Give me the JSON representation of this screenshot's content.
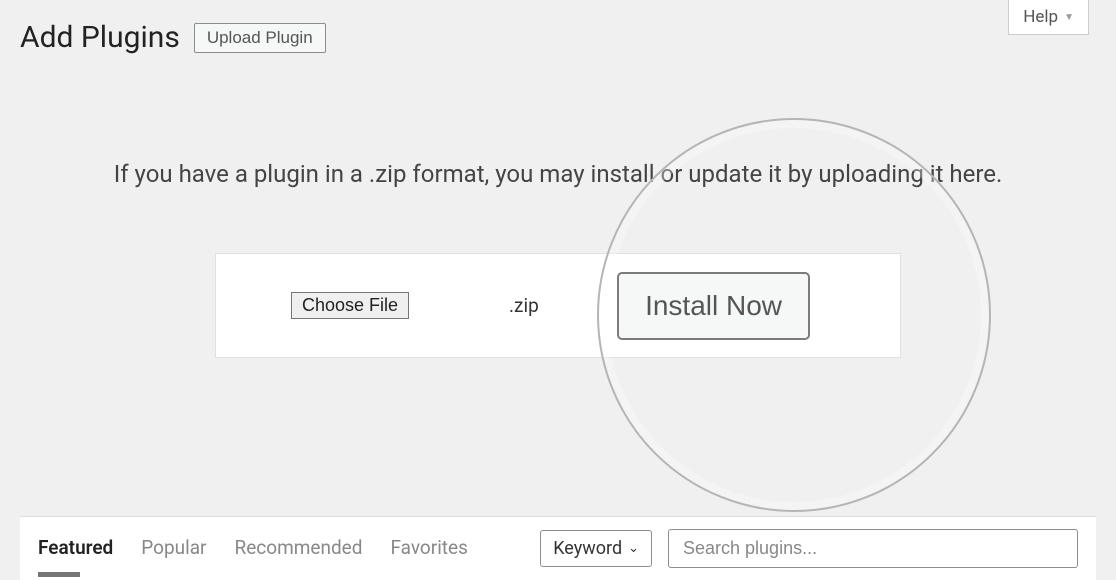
{
  "header": {
    "title": "Add Plugins",
    "upload_label": "Upload Plugin",
    "help_label": "Help"
  },
  "upload": {
    "instruction": "If you have a plugin in a .zip format, you may install or update it by uploading it here.",
    "choose_file_label": "Choose File",
    "file_ext": ".zip",
    "install_label": "Install Now"
  },
  "tabs": {
    "featured": "Featured",
    "popular": "Popular",
    "recommended": "Recommended",
    "favorites": "Favorites"
  },
  "search": {
    "filter_label": "Keyword",
    "placeholder": "Search plugins..."
  }
}
